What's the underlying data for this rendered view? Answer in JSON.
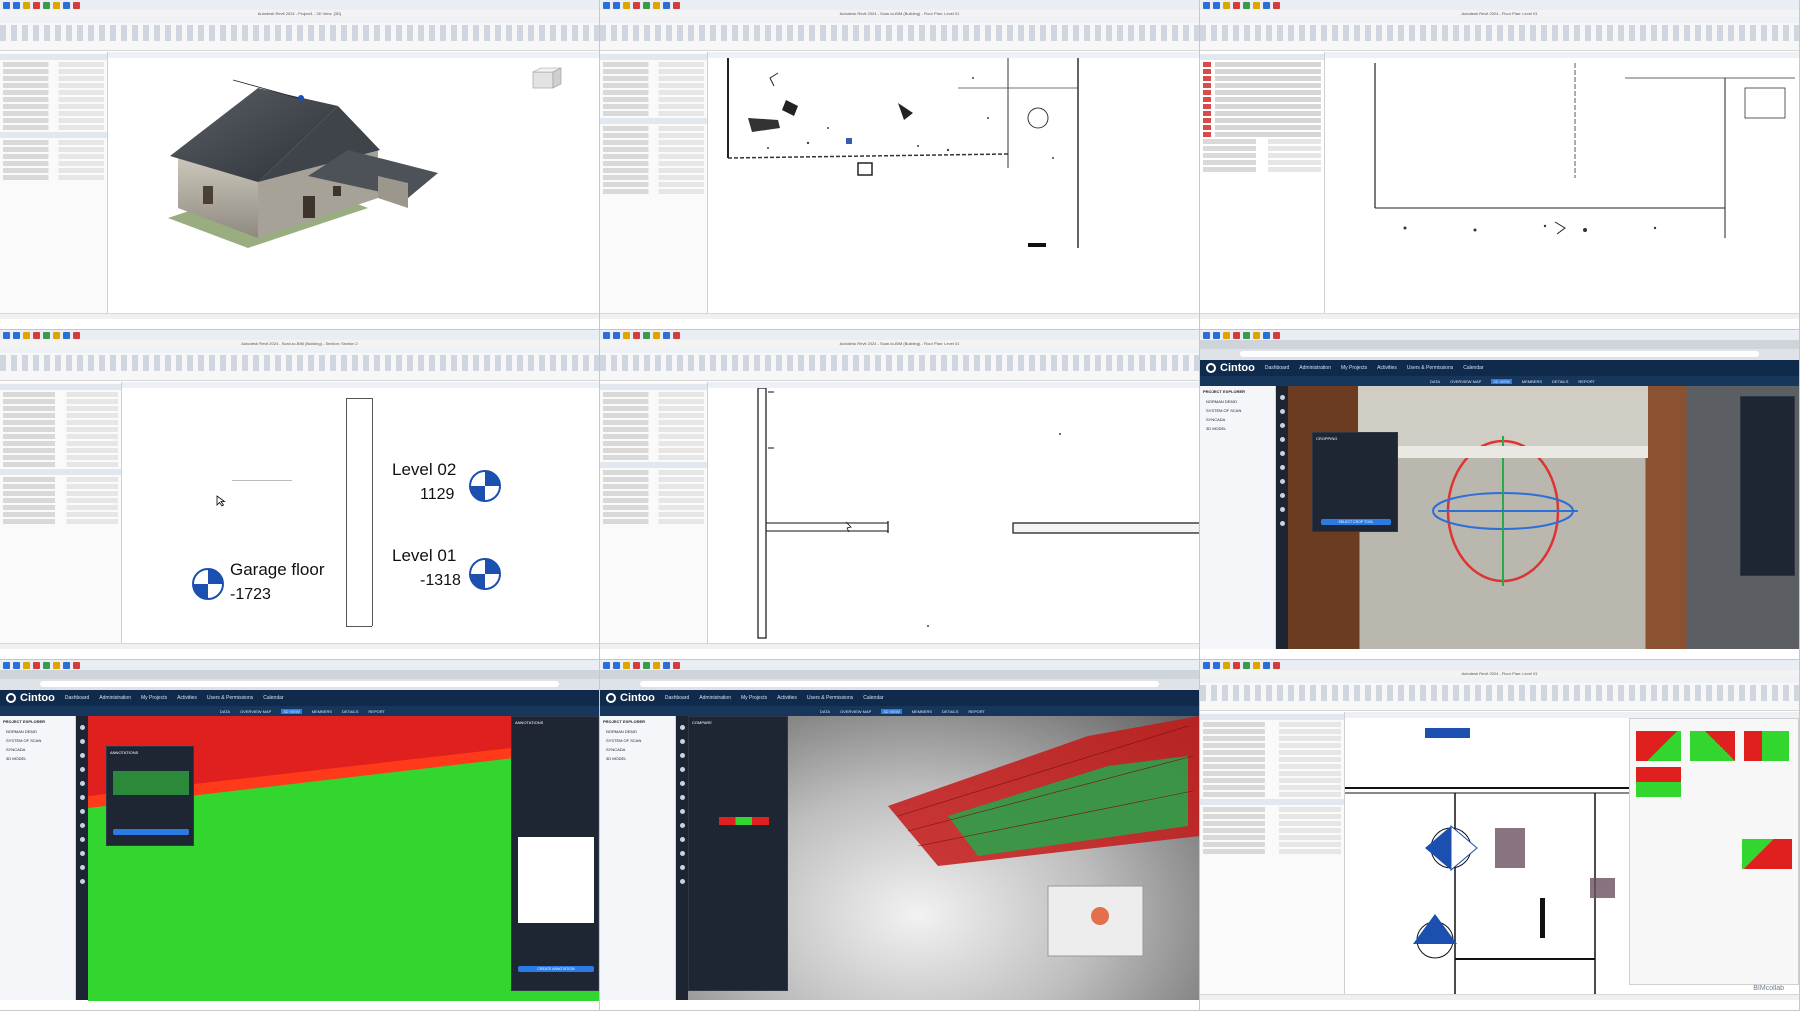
{
  "tiles": {
    "t1": {
      "window_title": "Autodesk Revit 2024 - Project1 - 3D View: {3D}",
      "view_tab": "{3D}"
    },
    "t2": {
      "window_title": "Autodesk Revit 2024 - Scan-to-BIM (Building) - Floor Plan: Level 01",
      "view_tab": "Level 01"
    },
    "t3": {
      "window_title": "Autodesk Revit 2024 - Floor Plan: Level 01",
      "view_tab": "Level 01"
    },
    "t4": {
      "window_title": "Autodesk Revit 2024 - Scan-to-BIM (Building) - Section: Section 2",
      "view_tab": "Section 2",
      "levels": [
        {
          "name": "Level 02",
          "elevation": "1129"
        },
        {
          "name": "Level 01",
          "elevation": "-1318"
        },
        {
          "name": "Garage floor",
          "elevation": "-1723"
        }
      ]
    },
    "t5": {
      "window_title": "Autodesk Revit 2024 - Scan-to-BIM (Building) - Floor Plan: Level 01",
      "view_tab": "Level 01"
    },
    "t6": {
      "brand": "Cintoo",
      "nav": [
        "Dashboard",
        "Administration",
        "My Projects",
        "Activities",
        "Users & Permissions",
        "Calendar"
      ],
      "subnav": [
        "DATA",
        "OVERVIEW MAP",
        "3D VIEW",
        "MEMBERS",
        "DETAILS",
        "REPORT"
      ],
      "explorer_title": "PROJECT EXPLORER",
      "explorer_items": [
        "NORMAN DEMO",
        "SYSTEM OF SCAN",
        "SYNCADA",
        "3D MODEL"
      ],
      "panel_title": "CROPPING",
      "panel_button": "SELECT CROP TOOL"
    },
    "t7": {
      "brand": "Cintoo",
      "nav": [
        "Dashboard",
        "Administration",
        "My Projects",
        "Activities",
        "Users & Permissions",
        "Calendar"
      ],
      "subnav": [
        "DATA",
        "OVERVIEW MAP",
        "3D VIEW",
        "MEMBERS",
        "DETAILS",
        "REPORT"
      ],
      "explorer_title": "PROJECT EXPLORER",
      "explorer_items": [
        "NORMAN DEMO",
        "SYSTEM OF SCAN",
        "SYNCADA",
        "3D MODEL"
      ],
      "panel_title": "ANNOTATIONS",
      "panel_button": "CREATE ANNOTATION"
    },
    "t8": {
      "brand": "Cintoo",
      "nav": [
        "Dashboard",
        "Administration",
        "My Projects",
        "Activities",
        "Users & Permissions",
        "Calendar"
      ],
      "subnav": [
        "DATA",
        "OVERVIEW MAP",
        "3D VIEW",
        "MEMBERS",
        "DETAILS",
        "REPORT"
      ],
      "explorer_title": "PROJECT EXPLORER",
      "explorer_items": [
        "NORMAN DEMO",
        "SYSTEM OF SCAN",
        "SYNCADA",
        "3D MODEL"
      ],
      "panel_title": "COMPARE"
    },
    "t9": {
      "window_title": "Autodesk Revit 2024 - Floor Plan: Level 01",
      "view_tab": "Level 01",
      "watermark": "BIMcollab"
    }
  },
  "colors": {
    "accent": "#2c7be5",
    "cintoo_nav": "#0f2a4a",
    "level_target": "#1b4fb0",
    "deviation_green": "#33d62f",
    "deviation_red": "#e01f1f"
  }
}
